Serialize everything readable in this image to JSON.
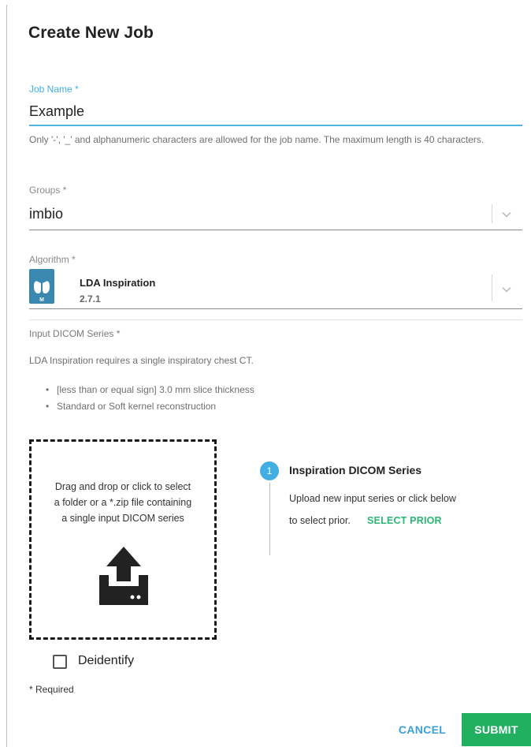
{
  "dialog": {
    "title": "Create New Job"
  },
  "job_name": {
    "label": "Job Name *",
    "value": "Example",
    "helper": "Only '-', '_' and alphanumeric characters are allowed for the job name. The maximum length is 40 characters."
  },
  "groups": {
    "label": "Groups *",
    "value": "imbio"
  },
  "algorithm": {
    "label": "Algorithm *",
    "name": "LDA Inspiration",
    "version": "2.7.1",
    "icon": "lungs-icon"
  },
  "input_series": {
    "label": "Input DICOM Series *",
    "requirement": "LDA Inspiration requires a single inspiratory chest CT.",
    "bullets": [
      "[less than or equal sign] 3.0 mm slice thickness",
      "Standard or Soft kernel reconstruction"
    ],
    "dropzone_text": "Drag and drop or click to select a folder or a *.zip file containing a single input DICOM series",
    "step": {
      "number": "1",
      "title": "Inspiration DICOM Series",
      "desc_line1": "Upload new input series or click below",
      "desc_line2": "to select prior.",
      "select_prior": "SELECT PRIOR"
    }
  },
  "deidentify": {
    "label": "Deidentify",
    "checked": false
  },
  "required_note": "* Required",
  "actions": {
    "cancel": "CANCEL",
    "submit": "SUBMIT"
  },
  "colors": {
    "accent_blue": "#3daee6",
    "submit_green": "#21b05f",
    "select_prior_green": "#2bb673",
    "algo_icon_bg": "#3a88b0"
  }
}
